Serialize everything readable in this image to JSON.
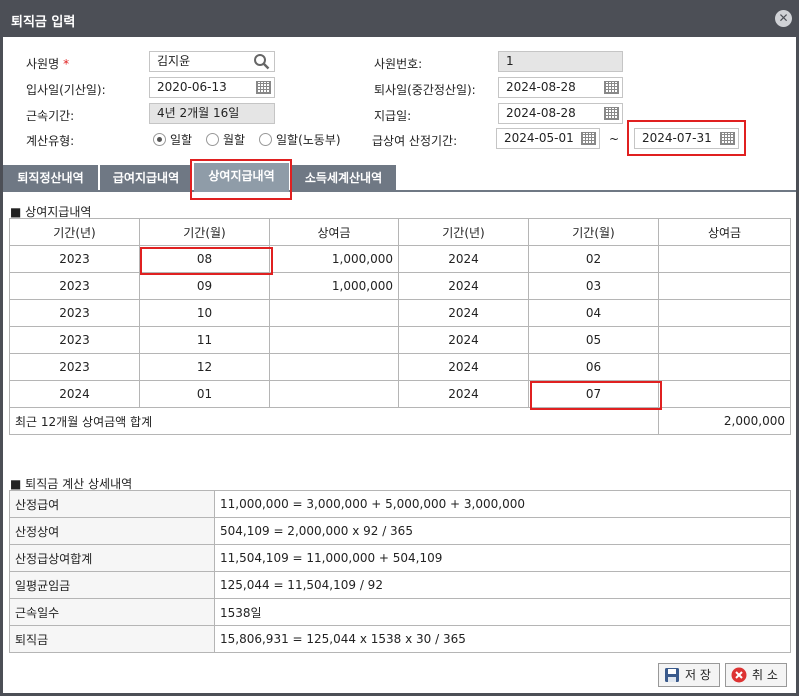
{
  "window": {
    "title": "퇴직금 입력",
    "close_glyph": "✕"
  },
  "form": {
    "employee_name_label": "사원명",
    "required_mark": "*",
    "employee_name_value": "김지윤",
    "employee_no_label": "사원번호:",
    "employee_no_value": "1",
    "hire_date_label": "입사일(기산일):",
    "hire_date_value": "2020-06-13",
    "retire_date_label": "퇴사일(중간정산일):",
    "retire_date_value": "2024-08-28",
    "service_period_label": "근속기간:",
    "service_period_value": "4년 2개월 16일",
    "pay_date_label": "지급일:",
    "pay_date_value": "2024-08-28",
    "calc_type_label": "계산유형:",
    "calc_type_options": [
      "일할",
      "월할",
      "일할(노동부)"
    ],
    "calc_type_selected": 0,
    "salary_period_label": "급상여 산정기간:",
    "salary_period_from": "2024-05-01",
    "salary_period_sep": "~",
    "salary_period_to": "2024-07-31"
  },
  "tabs": [
    {
      "label": "퇴직정산내역",
      "active": false
    },
    {
      "label": "급여지급내역",
      "active": false
    },
    {
      "label": "상여지급내역",
      "active": true
    },
    {
      "label": "소득세계산내역",
      "active": false
    }
  ],
  "bonus": {
    "section_title": "상여지급내역",
    "headers": [
      "기간(년)",
      "기간(월)",
      "상여금",
      "기간(년)",
      "기간(월)",
      "상여금"
    ],
    "rows": [
      [
        "2023",
        "08",
        "1,000,000",
        "2024",
        "02",
        ""
      ],
      [
        "2023",
        "09",
        "1,000,000",
        "2024",
        "03",
        ""
      ],
      [
        "2023",
        "10",
        "",
        "2024",
        "04",
        ""
      ],
      [
        "2023",
        "11",
        "",
        "2024",
        "05",
        ""
      ],
      [
        "2023",
        "12",
        "",
        "2024",
        "06",
        ""
      ],
      [
        "2024",
        "01",
        "",
        "2024",
        "07",
        ""
      ]
    ],
    "total_label": "최근 12개월 상여금액 합계",
    "total_value": "2,000,000"
  },
  "detail": {
    "section_title": "퇴직금 계산 상세내역",
    "rows": [
      {
        "label": "산정급여",
        "value": "11,000,000 = 3,000,000 + 5,000,000 + 3,000,000"
      },
      {
        "label": "산정상여",
        "value": "504,109 = 2,000,000 x 92 / 365"
      },
      {
        "label": "산정급상여합계",
        "value": "11,504,109 = 11,000,000 + 504,109"
      },
      {
        "label": "일평균임금",
        "value": "125,044 = 11,504,109 / 92"
      },
      {
        "label": "근속일수",
        "value": "1538일"
      },
      {
        "label": "퇴직금",
        "value": "15,806,931 = 125,044 x 1538 x 30 / 365"
      }
    ]
  },
  "buttons": {
    "save_label": "저 장",
    "cancel_label": "취 소"
  },
  "colors": {
    "title_bar": "#4c4f56",
    "tab": "#6f7884",
    "tab_active": "#8f9ca8",
    "highlight": "#e02020"
  }
}
